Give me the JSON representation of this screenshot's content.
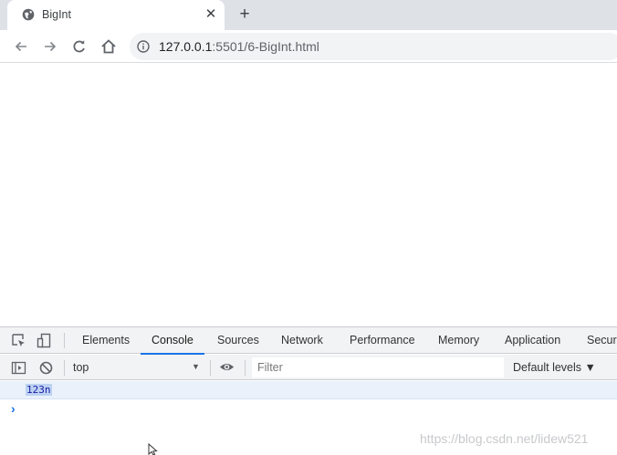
{
  "browser": {
    "tab": {
      "title": "BigInt",
      "favicon": "globe-icon",
      "close_glyph": "✕"
    },
    "new_tab_glyph": "+",
    "nav": {
      "back": "back-arrow-icon",
      "forward": "forward-arrow-icon",
      "reload": "reload-icon",
      "home": "home-icon"
    },
    "address": {
      "host": "127.0.0.1",
      "path": ":5501/6-BigInt.html",
      "security_icon": "info-icon"
    }
  },
  "devtools": {
    "tabs": [
      "Elements",
      "Console",
      "Sources",
      "Network",
      "Performance",
      "Memory",
      "Application",
      "Secur"
    ],
    "active_tab": "Console",
    "console": {
      "context": "top",
      "filter_placeholder": "Filter",
      "levels": "Default levels ▼",
      "messages": [
        "123n"
      ],
      "prompt": "›"
    }
  },
  "watermark": "https://blog.csdn.net/lidew521",
  "colors": {
    "accent": "#1a73e8",
    "log_highlight": "#bcd2f1",
    "tab_strip": "#dee1e6"
  }
}
